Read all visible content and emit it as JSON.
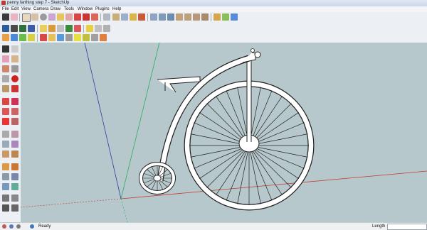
{
  "window": {
    "title": "penny farthing step 7 - SketchUp"
  },
  "menu": [
    "File",
    "Edit",
    "View",
    "Camera",
    "Draw",
    "Tools",
    "Window",
    "Plugins",
    "Help"
  ],
  "toolbar": {
    "row1_icons": [
      "select-icon",
      "eraser-icon",
      "paint-bucket-icon",
      "rectangle-icon",
      "circle-icon",
      "arc-icon",
      "push-pull-icon",
      "offset-icon",
      "move-icon",
      "rotate-icon",
      "scale-icon",
      "tape-measure-icon",
      "dimension-icon",
      "text-icon",
      "orbit-icon",
      "pan-icon",
      "zoom-icon",
      "zoom-extents-icon",
      "previous-view-icon",
      "iso-view-icon",
      "top-view-icon",
      "front-view-icon",
      "right-view-icon",
      "back-view-icon",
      "left-view-icon"
    ],
    "row2_icons": [
      "3d-warehouse-icon",
      "get-models-icon",
      "share-model-icon",
      "component-icon",
      "section-plane-icon",
      "display-section-icon",
      "solid-tools-icon",
      "layer-icon",
      "styles-icon",
      "shadow-icon",
      "fog-icon",
      "x-ray-icon",
      "edge-style-icon"
    ]
  },
  "status": {
    "message": "Ready",
    "length_label": "Length",
    "length_value": ""
  },
  "colors": {
    "viewport_bg": "#b7c8cc",
    "axis_red": "#c0392b",
    "axis_green": "#27ae60",
    "axis_blue": "#2c3e9e"
  }
}
